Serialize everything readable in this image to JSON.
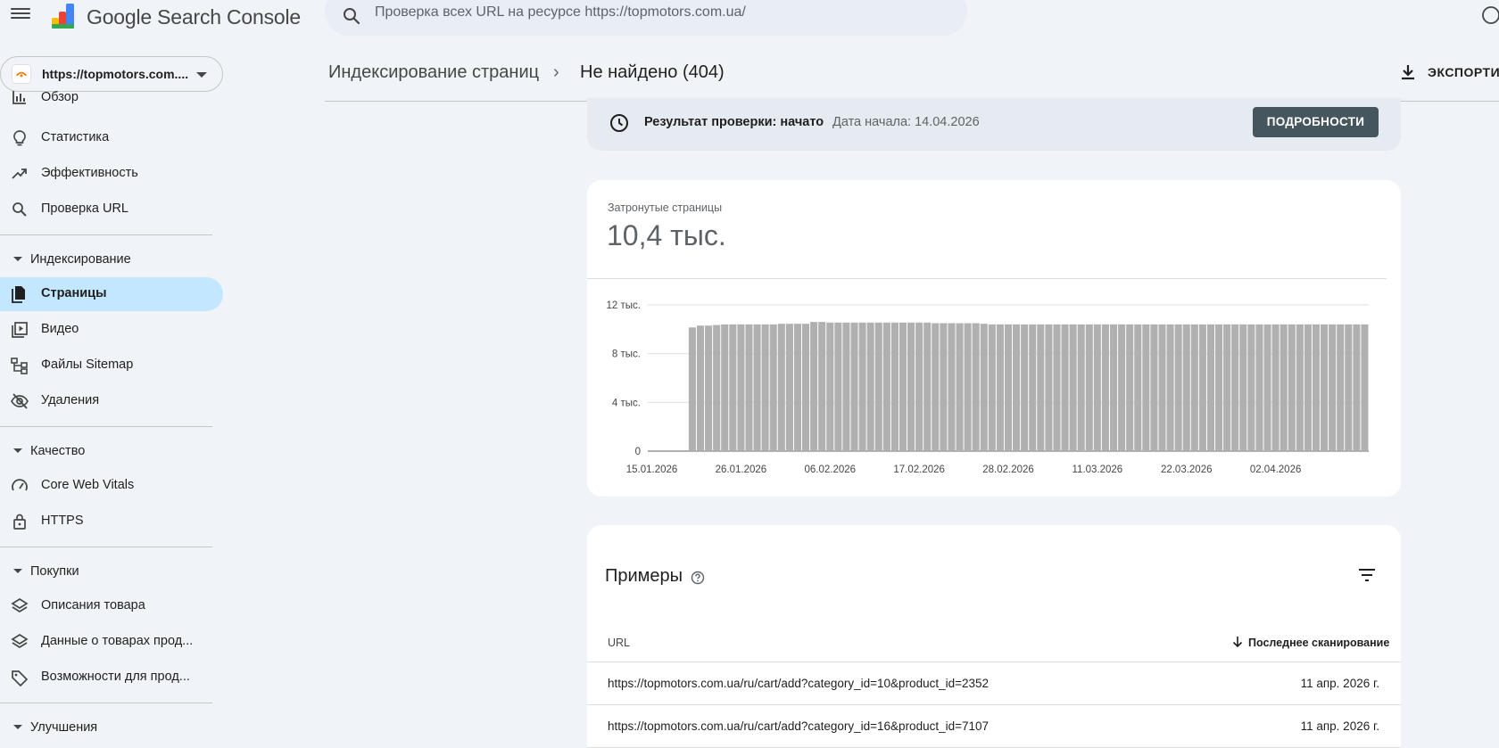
{
  "app": {
    "brand": "Google Search Console"
  },
  "search": {
    "placeholder": "Проверка всех URL на ресурсе https://topmotors.com.ua/"
  },
  "property": {
    "label": "https://topmotors.com...."
  },
  "sidebar": {
    "items": [
      {
        "label": "Обзор",
        "icon": "bar-chart-icon"
      },
      {
        "label": "Статистика",
        "icon": "lightbulb-icon"
      },
      {
        "label": "Эффективность",
        "icon": "trending-up-icon"
      },
      {
        "label": "Проверка URL",
        "icon": "search-icon"
      }
    ],
    "indexing": {
      "label": "Индексирование",
      "items": [
        {
          "label": "Страницы",
          "icon": "file-copy-icon",
          "active": true
        },
        {
          "label": "Видео",
          "icon": "video-library-icon"
        },
        {
          "label": "Файлы Sitemap",
          "icon": "sitemap-icon"
        },
        {
          "label": "Удаления",
          "icon": "visibility-off-icon"
        }
      ]
    },
    "quality": {
      "label": "Качество",
      "items": [
        {
          "label": "Core Web Vitals",
          "icon": "speed-gauge-icon"
        },
        {
          "label": "HTTPS",
          "icon": "lock-icon"
        }
      ]
    },
    "shopping": {
      "label": "Покупки",
      "items": [
        {
          "label": "Описания товара",
          "icon": "layers-icon"
        },
        {
          "label": "Данные о товарах прод...",
          "icon": "layers-icon"
        },
        {
          "label": "Возможности для прод...",
          "icon": "tag-icon"
        }
      ]
    },
    "enhancements": {
      "label": "Улучшения"
    }
  },
  "header": {
    "breadcrumb_parent": "Индексирование страниц",
    "breadcrumb_sep": "›",
    "breadcrumb_current": "Не найдено (404)",
    "export_label": "ЭКСПОРТИР"
  },
  "status": {
    "title": "Результат проверки: начато",
    "date": "Дата начала: 14.04.2026",
    "details_label": "ПОДРОБНОСТИ"
  },
  "summary": {
    "caption": "Затронутые страницы",
    "value": "10,4 тыс."
  },
  "chart_data": {
    "type": "bar",
    "xlabel": "",
    "ylabel": "",
    "ylim": [
      0,
      12000
    ],
    "yticks": [
      0,
      4000,
      8000,
      12000
    ],
    "ytick_labels": [
      "0",
      "4 тыс.",
      "8 тыс.",
      "12 тыс."
    ],
    "xtick_labels": [
      "15.01.2026",
      "26.01.2026",
      "06.02.2026",
      "17.02.2026",
      "28.02.2026",
      "11.03.2026",
      "22.03.2026",
      "02.04.2026"
    ],
    "first_date": "15.01.2026",
    "values": [
      0,
      0,
      0,
      0,
      0,
      10150,
      10300,
      10300,
      10350,
      10400,
      10400,
      10400,
      10400,
      10400,
      10400,
      10400,
      10450,
      10450,
      10450,
      10450,
      10600,
      10600,
      10550,
      10550,
      10550,
      10550,
      10550,
      10550,
      10550,
      10550,
      10550,
      10550,
      10550,
      10550,
      10550,
      10500,
      10500,
      10500,
      10500,
      10500,
      10500,
      10450,
      10400,
      10400,
      10400,
      10400,
      10400,
      10400,
      10400,
      10400,
      10400,
      10400,
      10400,
      10400,
      10400,
      10400,
      10400,
      10400,
      10400,
      10400,
      10400,
      10400,
      10400,
      10400,
      10400,
      10400,
      10400,
      10400,
      10400,
      10400,
      10400,
      10400,
      10400,
      10400,
      10400,
      10400,
      10400,
      10400,
      10400,
      10400,
      10400,
      10400,
      10400,
      10400,
      10400,
      10400,
      10400,
      10400,
      10400
    ],
    "bar_color": "#b0b0b0"
  },
  "examples": {
    "title": "Примеры",
    "col_url": "URL",
    "col_last_crawl": "Последнее сканирование",
    "rows": [
      {
        "url": "https://topmotors.com.ua/ru/cart/add?category_id=10&product_id=2352",
        "date": "11 апр. 2026 г."
      },
      {
        "url": "https://topmotors.com.ua/ru/cart/add?category_id=16&product_id=7107",
        "date": "11 апр. 2026 г."
      }
    ]
  }
}
